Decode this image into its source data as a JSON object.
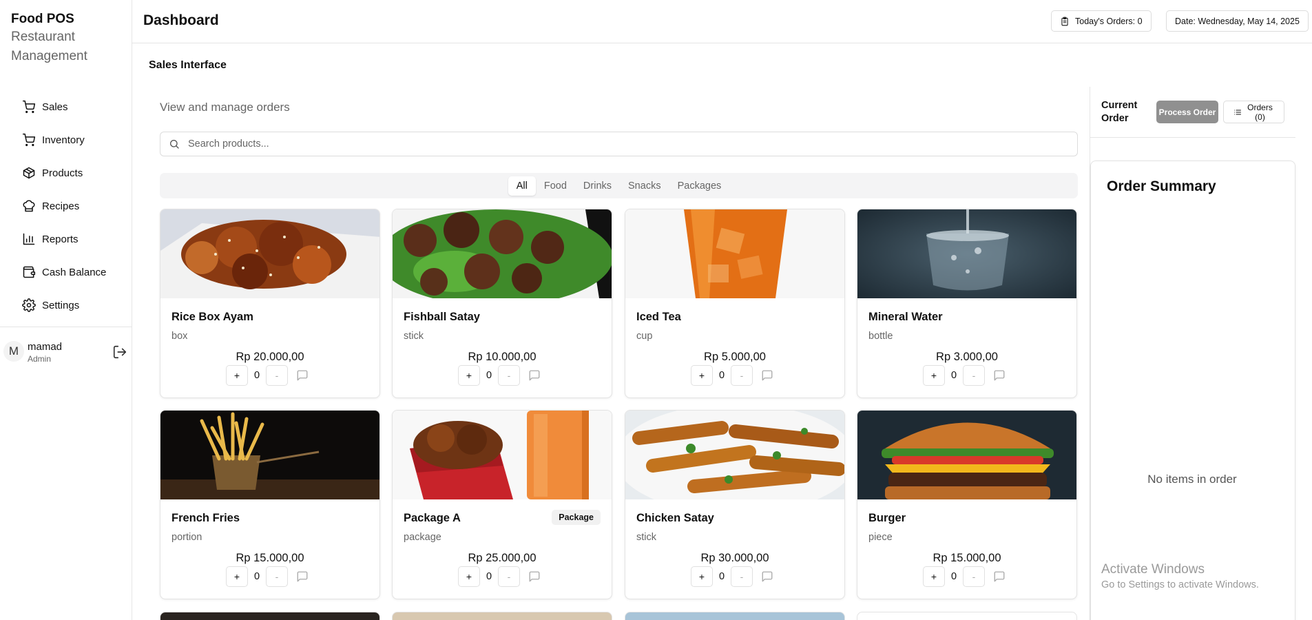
{
  "brand": {
    "title": "Food POS",
    "subtitle": "Restaurant Management"
  },
  "sidebar": {
    "items": [
      {
        "label": "Sales",
        "icon": "cart-icon"
      },
      {
        "label": "Inventory",
        "icon": "cart-icon"
      },
      {
        "label": "Products",
        "icon": "package-icon"
      },
      {
        "label": "Recipes",
        "icon": "chef-hat-icon"
      },
      {
        "label": "Reports",
        "icon": "bar-chart-icon"
      },
      {
        "label": "Cash Balance",
        "icon": "wallet-icon"
      },
      {
        "label": "Settings",
        "icon": "gear-icon"
      }
    ]
  },
  "user": {
    "initial": "M",
    "name": "mamad",
    "role": "Admin"
  },
  "header": {
    "title": "Dashboard",
    "todays_orders": "Today's Orders: 0",
    "date": "Date: Wednesday, May 14, 2025"
  },
  "main": {
    "section_title": "Sales Interface",
    "subtitle": "View and manage orders",
    "search_placeholder": "Search products...",
    "tabs": [
      "All",
      "Food",
      "Drinks",
      "Snacks",
      "Packages"
    ],
    "active_tab": "All"
  },
  "products": [
    {
      "name": "Rice Box Ayam",
      "unit": "box",
      "price": "Rp 20.000,00",
      "qty": "0",
      "badge": ""
    },
    {
      "name": "Fishball Satay",
      "unit": "stick",
      "price": "Rp 10.000,00",
      "qty": "0",
      "badge": ""
    },
    {
      "name": "Iced Tea",
      "unit": "cup",
      "price": "Rp 5.000,00",
      "qty": "0",
      "badge": ""
    },
    {
      "name": "Mineral Water",
      "unit": "bottle",
      "price": "Rp 3.000,00",
      "qty": "0",
      "badge": ""
    },
    {
      "name": "French Fries",
      "unit": "portion",
      "price": "Rp 15.000,00",
      "qty": "0",
      "badge": ""
    },
    {
      "name": "Package A",
      "unit": "package",
      "price": "Rp 25.000,00",
      "qty": "0",
      "badge": "Package"
    },
    {
      "name": "Chicken Satay",
      "unit": "stick",
      "price": "Rp 30.000,00",
      "qty": "0",
      "badge": ""
    },
    {
      "name": "Burger",
      "unit": "piece",
      "price": "Rp 15.000,00",
      "qty": "0",
      "badge": ""
    }
  ],
  "qty_controls": {
    "plus": "+",
    "minus": "-"
  },
  "order_panel": {
    "current_order": "Current Order",
    "process_button": "Process Order",
    "orders_button": "Orders (0)",
    "summary_title": "Order Summary",
    "empty_message": "No items in order"
  },
  "watermark": {
    "line1": "Activate Windows",
    "line2": "Go to Settings to activate Windows."
  },
  "colors": {
    "accent_dark": "#111111",
    "muted": "#666666",
    "process_button_bg": "#909090",
    "tabs_bg": "#f4f4f5"
  }
}
